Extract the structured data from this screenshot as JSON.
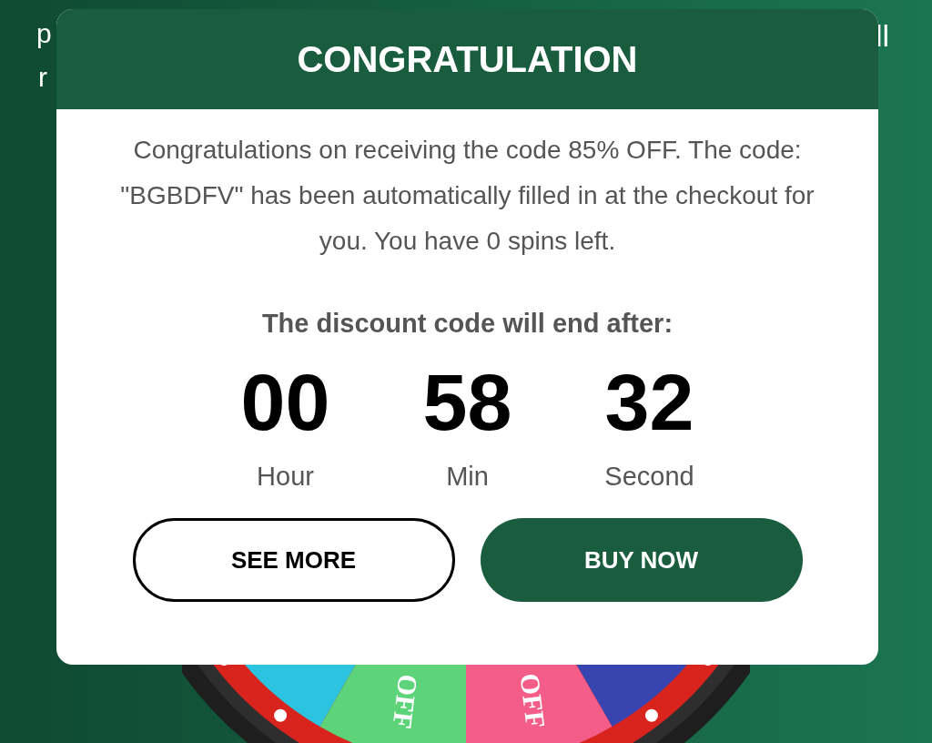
{
  "background_text": [
    "p",
    "r",
    "ll"
  ],
  "wheel": {
    "labels": [
      {
        "text": "OFF",
        "color": "#5dd47a"
      },
      {
        "text": "OFF",
        "color": "#f45d87"
      }
    ]
  },
  "dialog": {
    "title": "CONGRATULATION",
    "message": "Congratulations on receiving the code 85% OFF. The code: \"BGBDFV\" has been automatically filled in at the checkout for you. You have 0 spins left.",
    "countdown_label": "The discount code will end after:",
    "countdown": [
      {
        "value": "00",
        "unit": "Hour"
      },
      {
        "value": "58",
        "unit": "Min"
      },
      {
        "value": "32",
        "unit": "Second"
      }
    ],
    "buttons": [
      {
        "label": "SEE MORE",
        "kind": "outline"
      },
      {
        "label": "BUY NOW",
        "kind": "filled"
      }
    ]
  }
}
